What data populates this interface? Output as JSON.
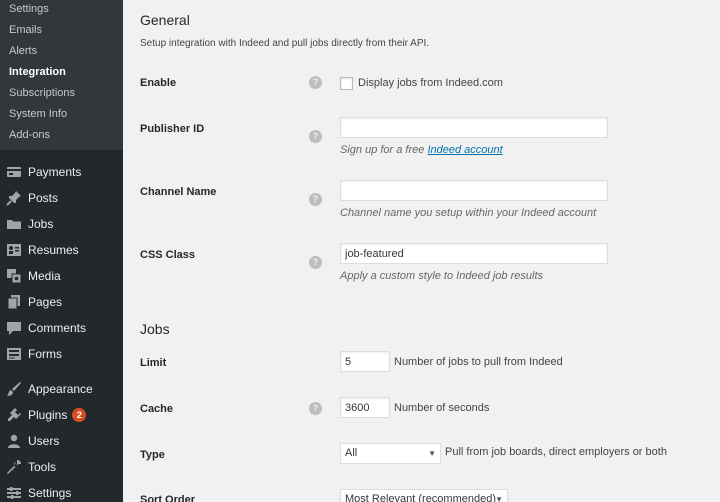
{
  "sidebar": {
    "submenu": [
      {
        "label": "Settings"
      },
      {
        "label": "Emails"
      },
      {
        "label": "Alerts"
      },
      {
        "label": "Integration",
        "current": true
      },
      {
        "label": "Subscriptions"
      },
      {
        "label": "System Info"
      },
      {
        "label": "Add-ons"
      }
    ],
    "menu": [
      {
        "label": "Payments",
        "icon": "payments-icon"
      },
      {
        "label": "Posts",
        "icon": "pin-icon"
      },
      {
        "label": "Jobs",
        "icon": "folder-icon"
      },
      {
        "label": "Resumes",
        "icon": "resume-icon"
      },
      {
        "label": "Media",
        "icon": "media-icon"
      },
      {
        "label": "Pages",
        "icon": "pages-icon"
      },
      {
        "label": "Comments",
        "icon": "comments-icon"
      },
      {
        "label": "Forms",
        "icon": "forms-icon"
      },
      {
        "label": "Appearance",
        "icon": "appearance-icon"
      },
      {
        "label": "Plugins",
        "icon": "plugins-icon",
        "badge": "2"
      },
      {
        "label": "Users",
        "icon": "users-icon"
      },
      {
        "label": "Tools",
        "icon": "tools-icon"
      },
      {
        "label": "Settings",
        "icon": "settings-icon"
      }
    ]
  },
  "general": {
    "title": "General",
    "description": "Setup integration with Indeed and pull jobs directly from their API.",
    "enable": {
      "label": "Enable",
      "checkbox_label": "Display jobs from Indeed.com",
      "checked": false
    },
    "publisher_id": {
      "label": "Publisher ID",
      "value": "",
      "note_prefix": "Sign up for a free ",
      "note_link": "Indeed account"
    },
    "channel_name": {
      "label": "Channel Name",
      "value": "",
      "note": "Channel name you setup within your Indeed account"
    },
    "css_class": {
      "label": "CSS Class",
      "value": "job-featured",
      "note": "Apply a custom style to Indeed job results"
    }
  },
  "jobs": {
    "title": "Jobs",
    "limit": {
      "label": "Limit",
      "value": "5",
      "note": "Number of jobs to pull from Indeed"
    },
    "cache": {
      "label": "Cache",
      "value": "3600",
      "note": "Number of seconds"
    },
    "type": {
      "label": "Type",
      "value": "All",
      "note": "Pull from job boards, direct employers or both"
    },
    "sort_order": {
      "label": "Sort Order",
      "value": "Most Relevant (recommended)"
    }
  },
  "help_glyph": "?",
  "select_arrow": "▼",
  "colors": {
    "sidebar_bg": "#23282d",
    "submenu_bg": "#32373c",
    "content_bg": "#f1f1f1",
    "link": "#0073aa",
    "badge": "#d54e21"
  }
}
